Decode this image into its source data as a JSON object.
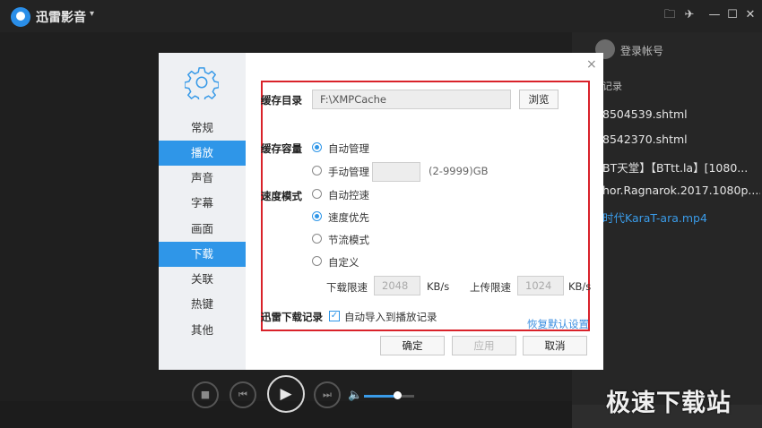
{
  "window": {
    "title": "迅雷影音",
    "caret": "▾",
    "controls": {
      "folder": "🗀",
      "pin": "✈",
      "minimize": "—",
      "maximize": "☐",
      "close": "✕"
    }
  },
  "playlist": {
    "login": "登录帐号",
    "section": "记录",
    "items": [
      "8504539.shtml",
      "8542370.shtml",
      "BT天堂】【BTtt.la】[1080...",
      "hor.Ragnarok.2017.1080p....",
      "时代KaraT-ara.mp4"
    ],
    "active_color": "#3a9be8"
  },
  "watermark": "极速下载站",
  "player": {
    "stop": "■",
    "prev": "⏮",
    "play": "▶",
    "next": "⏭",
    "volume_icon": "🔈",
    "volume_level": 0.66
  },
  "dialog": {
    "close": "×",
    "nav": [
      "常规",
      "播放",
      "声音",
      "字幕",
      "画面",
      "下载",
      "关联",
      "热键",
      "其他"
    ],
    "nav_active": [
      "播放",
      "下载"
    ],
    "cache_dir": {
      "label": "缓存目录",
      "value": "F:\\XMPCache",
      "browse": "浏览"
    },
    "cache_size": {
      "label": "缓存容量",
      "auto": "自动管理",
      "manual": "手动管理",
      "manual_value": "",
      "range": "(2-9999)GB"
    },
    "speed_mode": {
      "label": "速度模式",
      "options": [
        "自动控速",
        "速度优先",
        "节流模式",
        "自定义"
      ],
      "selected": "速度优先"
    },
    "limits": {
      "download_label": "下载限速",
      "download_value": "2048",
      "download_unit": "KB/s",
      "upload_label": "上传限速",
      "upload_value": "1024",
      "upload_unit": "KB/s"
    },
    "xunlei_record": {
      "label": "迅雷下载记录",
      "checkbox": "自动导入到播放记录",
      "checked": true
    },
    "restore_default": "恢复默认设置",
    "buttons": {
      "ok": "确定",
      "apply": "应用",
      "cancel": "取消"
    },
    "highlight_color": "#d9222a",
    "accent_color": "#2f96e8"
  }
}
